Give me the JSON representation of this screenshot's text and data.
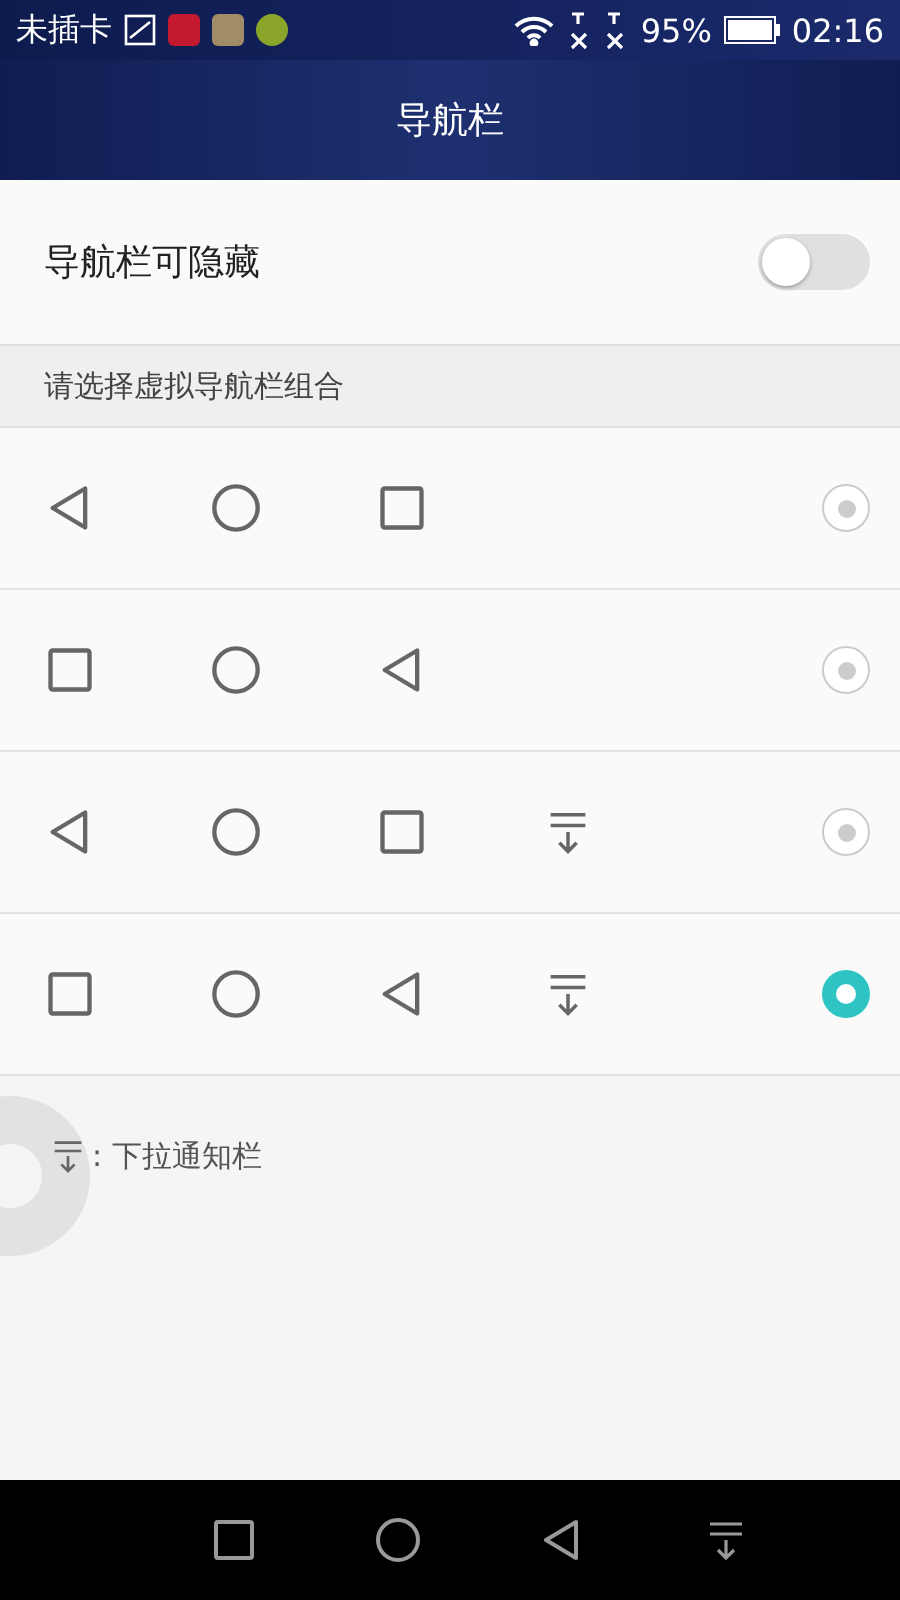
{
  "status_bar": {
    "carrier": "未插卡",
    "battery": "95%",
    "time": "02:16"
  },
  "header": {
    "title": "导航栏"
  },
  "hide_setting": {
    "label": "导航栏可隐藏",
    "on": false
  },
  "section": {
    "title": "请选择虚拟导航栏组合"
  },
  "combos": [
    {
      "keys": [
        {
          "kind": "back"
        },
        {
          "kind": "home"
        },
        {
          "kind": "recent"
        }
      ],
      "selected": false
    },
    {
      "keys": [
        {
          "kind": "recent"
        },
        {
          "kind": "home"
        },
        {
          "kind": "back"
        }
      ],
      "selected": false
    },
    {
      "keys": [
        {
          "kind": "back"
        },
        {
          "kind": "home"
        },
        {
          "kind": "recent"
        },
        {
          "kind": "notify"
        }
      ],
      "selected": false
    },
    {
      "keys": [
        {
          "kind": "recent"
        },
        {
          "kind": "home"
        },
        {
          "kind": "back"
        },
        {
          "kind": "notify"
        }
      ],
      "selected": true
    }
  ],
  "legend": {
    "text": ": 下拉通知栏"
  },
  "nav_bar": {
    "keys": [
      {
        "kind": "recent"
      },
      {
        "kind": "home"
      },
      {
        "kind": "back"
      },
      {
        "kind": "notify"
      }
    ]
  }
}
